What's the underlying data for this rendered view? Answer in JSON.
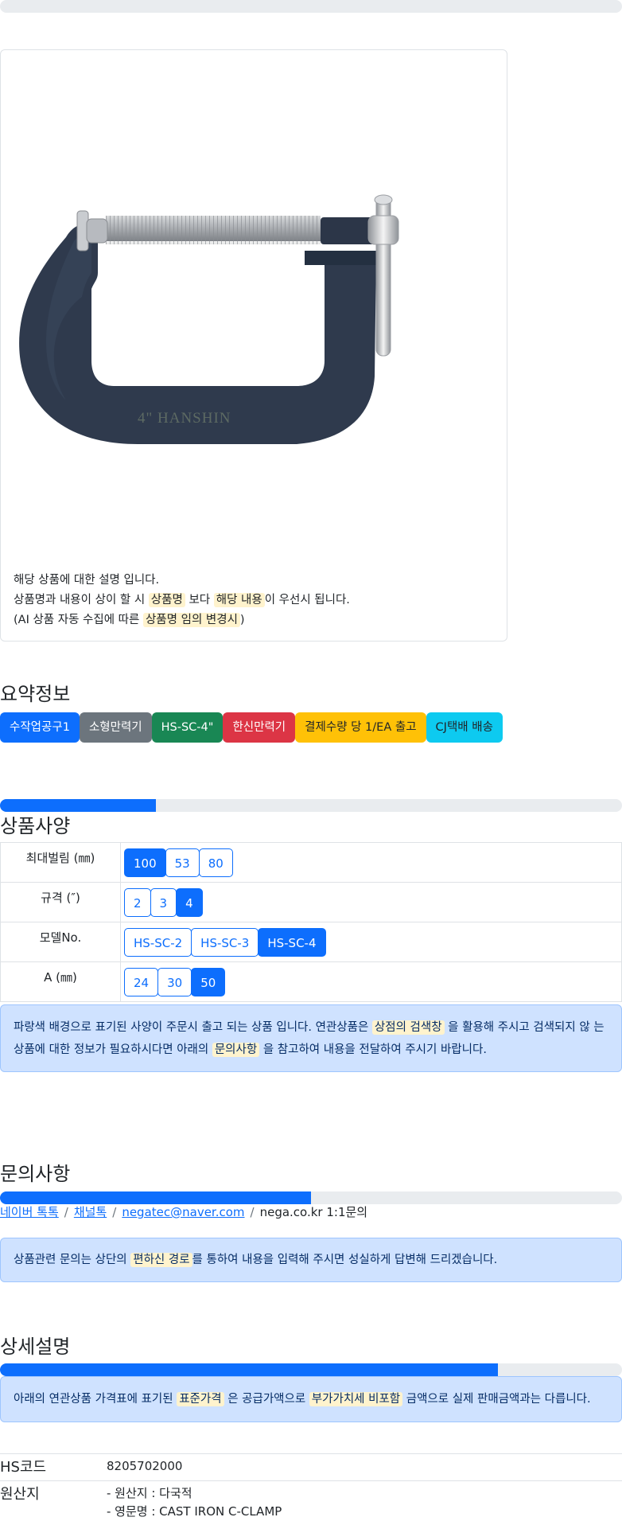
{
  "product_description": {
    "line1": "해당 상품에 대한 설명 입니다.",
    "line2_a": "상품명과 내용이 상이 할 시",
    "line2_hl1": "상품명",
    "line2_b": "보다",
    "line2_hl2": "해당 내용",
    "line2_c": "이 우선시 됩니다.",
    "line3_a": "(AI 상품 자동 수집에 따른",
    "line3_hl": "상품명 임의 변경시",
    "line3_b": ")",
    "image_text": "4\" HANSHIN"
  },
  "summary": {
    "title": "요약정보",
    "badges": [
      "수작업공구1",
      "소형만력기",
      "HS-SC-4\"",
      "한신만력기",
      "결제수량 당 1/EA 출고",
      "CJ택배 배송"
    ]
  },
  "specs": {
    "title": "상품사양",
    "progress_fraction": 0.25,
    "rows": [
      {
        "label": "최대벌림 (㎜)",
        "options": [
          "100",
          "53",
          "80"
        ],
        "active": "100"
      },
      {
        "label": "규격 (″)",
        "options": [
          "2",
          "3",
          "4"
        ],
        "active": "4"
      },
      {
        "label": "모델No.",
        "options": [
          "HS-SC-2",
          "HS-SC-3",
          "HS-SC-4"
        ],
        "active": "HS-SC-4"
      },
      {
        "label": "A (㎜)",
        "options": [
          "24",
          "30",
          "50"
        ],
        "active": "50"
      }
    ],
    "note_a": "파랑색 배경으로 표기된 사양이 주문시 출고 되는 상품 입니다. 연관상품은",
    "note_hl1": "상점의 검색창",
    "note_b": "을 활용해 주시고 검색되지 않",
    "note_c": "는 상품에 대한 정보가 필요하시다면 아래의",
    "note_hl2": "문의사항",
    "note_d": "을 참고하여 내용을 전달하여 주시기 바랍니다."
  },
  "inquiry": {
    "title": "문의사항",
    "progress_fraction": 0.5,
    "links": [
      "네이버 톡톡",
      "채널톡",
      "negatec@naver.com"
    ],
    "plain": "nega.co.kr 1:1문의",
    "note_a": "상품관련 문의는 상단의",
    "note_hl": "편하신 경로",
    "note_b": "를 통하여 내용을 입력해 주시면 성실하게 답변해 드리겠습니다."
  },
  "detail": {
    "title": "상세설명",
    "progress_fraction": 0.8,
    "note_a": "아래의 연관상품 가격표에 표기된",
    "note_hl1": "표준가격",
    "note_b": "은 공급가액으로",
    "note_hl2": "부가가치세 비포함",
    "note_c": "금액으로 실제 판매금액과는 다릅니다.",
    "hs_key": "HS코드",
    "hs_val": "8205702000",
    "origin_key": "원산지",
    "origin_val1": "- 원산지 : 다국적",
    "origin_val2": "- 영문명 : CAST IRON C-CLAMP"
  },
  "colors": {
    "primary": "#0d6efd",
    "highlight": "#fff3cd",
    "clamp_body": "#2f3a4d"
  }
}
